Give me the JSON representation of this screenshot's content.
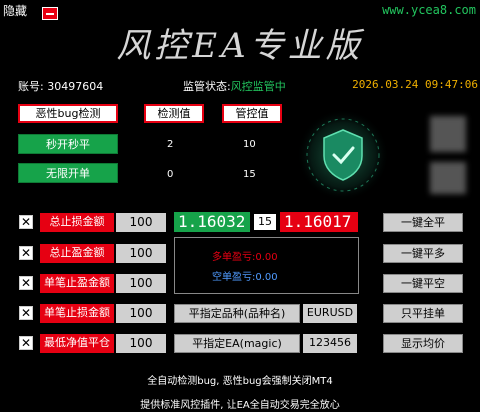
{
  "header": {
    "hide_label": "隐藏",
    "website": "www.ycea8.com",
    "title": "风控EA专业版"
  },
  "status": {
    "account_label": "账号:",
    "account_value": "30497604",
    "monitor_label": "监管状态:",
    "monitor_value": "风控监管中",
    "datetime": "2026.03.24 09:47:06"
  },
  "detect": {
    "button_bug": "恶性bug检测",
    "header_detect": "检测值",
    "header_control": "管控值",
    "rows": [
      {
        "label": "秒开秒平",
        "detect": "2",
        "control": "10"
      },
      {
        "label": "无限开单",
        "detect": "0",
        "control": "15"
      }
    ]
  },
  "controls": {
    "rows": [
      {
        "checked": "✕",
        "label": "总止损金额",
        "value": "100"
      },
      {
        "checked": "✕",
        "label": "总止盈金额",
        "value": "100"
      },
      {
        "checked": "✕",
        "label": "单笔止盈金额",
        "value": "100"
      },
      {
        "checked": "✕",
        "label": "单笔止损金额",
        "value": "100"
      },
      {
        "checked": "✕",
        "label": "最低净值平仓",
        "value": "100"
      }
    ],
    "bid": "1.16032",
    "spread": "15",
    "ask": "1.16017",
    "long_profit_label": "多单盈亏:",
    "long_profit_value": "0.00",
    "short_profit_label": "空单盈亏:",
    "short_profit_value": "0.00",
    "symbol_button": "平指定品种(品种名)",
    "symbol_value": "EURUSD",
    "magic_button": "平指定EA(magic)",
    "magic_value": "123456"
  },
  "actions": {
    "close_all": "一键全平",
    "close_long": "一键平多",
    "close_short": "一键平空",
    "close_pending": "只平挂单",
    "show_avg": "显示均价"
  },
  "footer": {
    "line1": "全自动检测bug, 恶性bug会强制关闭MT4",
    "line2": "提供标准风控插件, 让EA全自动交易完全放心"
  },
  "colors": {
    "accent_red": "#e60012",
    "accent_green": "#16a34a",
    "date_orange": "#f0b000"
  }
}
